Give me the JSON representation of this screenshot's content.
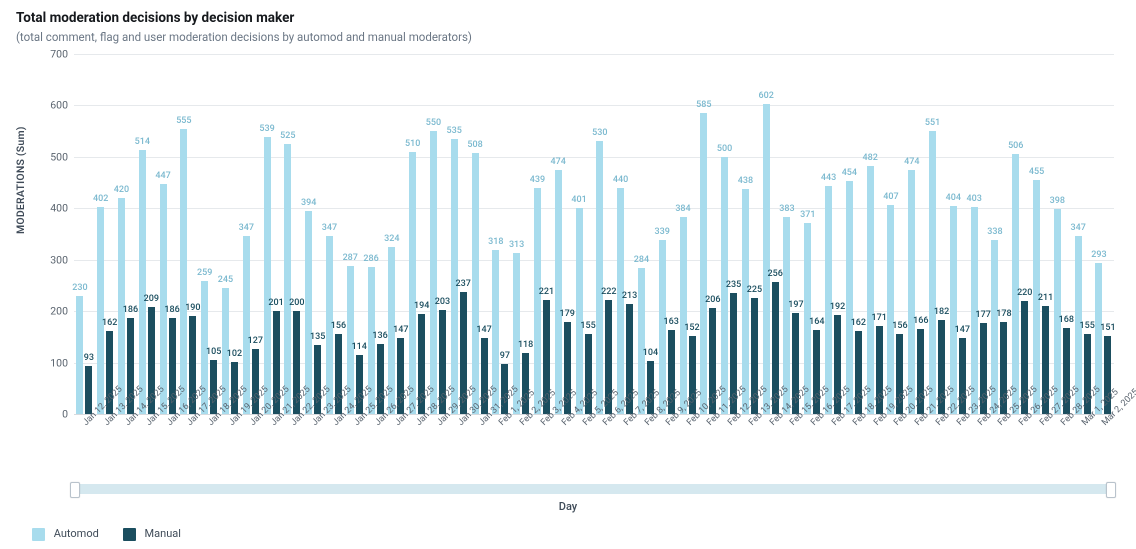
{
  "title": "Total moderation decisions by decision maker",
  "subtitle": "(total comment, flag and user moderation decisions by automod and manual moderators)",
  "legend": {
    "automod": "Automod",
    "manual": "Manual"
  },
  "axis": {
    "y": "MODERATIONS (Sum)",
    "x": "Day"
  },
  "chart_data": {
    "type": "bar",
    "ylim": [
      0,
      700
    ],
    "yticks": [
      0,
      100,
      200,
      300,
      400,
      500,
      600,
      700
    ],
    "categories": [
      "Jan 12, 2025",
      "Jan 13, 2025",
      "Jan 14, 2025",
      "Jan 15, 2025",
      "Jan 16, 2025",
      "Jan 17, 2025",
      "Jan 18, 2025",
      "Jan 19, 2025",
      "Jan 20, 2025",
      "Jan 21, 2025",
      "Jan 22, 2025",
      "Jan 23, 2025",
      "Jan 24, 2025",
      "Jan 25, 2025",
      "Jan 26, 2025",
      "Jan 27, 2025",
      "Jan 28, 2025",
      "Jan 29, 2025",
      "Jan 30, 2025",
      "Jan 31, 2025",
      "Feb 1, 2025",
      "Feb 2, 2025",
      "Feb 3, 2025",
      "Feb 4, 2025",
      "Feb 5, 2025",
      "Feb 6, 2025",
      "Feb 7, 2025",
      "Feb 8, 2025",
      "Feb 9, 2025",
      "Feb 10, 2025",
      "Feb 11, 2025",
      "Feb 12, 2025",
      "Feb 13, 2025",
      "Feb 14, 2025",
      "Feb 15, 2025",
      "Feb 16, 2025",
      "Feb 17, 2025",
      "Feb 18, 2025",
      "Feb 19, 2025",
      "Feb 20, 2025",
      "Feb 21, 2025",
      "Feb 22, 2025",
      "Feb 23, 2025",
      "Feb 24, 2025",
      "Feb 25, 2025",
      "Feb 26, 2025",
      "Feb 27, 2025",
      "Feb 28, 2025",
      "Mar 1, 2025",
      "Mar 2, 2025"
    ],
    "series": [
      {
        "name": "Automod",
        "color": "#a8dced",
        "values": [
          230,
          402,
          420,
          514,
          447,
          555,
          259,
          245,
          347,
          539,
          525,
          394,
          347,
          287,
          286,
          324,
          510,
          550,
          535,
          508,
          318,
          313,
          439,
          474,
          401,
          530,
          440,
          284,
          339,
          384,
          585,
          500,
          438,
          602,
          383,
          371,
          443,
          454,
          482,
          407,
          474,
          551,
          404,
          403,
          338,
          506,
          455,
          398,
          347,
          293
        ]
      },
      {
        "name": "Manual",
        "color": "#1b4e5f",
        "values": [
          93,
          162,
          186,
          209,
          186,
          190,
          105,
          102,
          127,
          201,
          200,
          135,
          156,
          114,
          136,
          147,
          194,
          203,
          237,
          147,
          97,
          118,
          221,
          179,
          155,
          222,
          213,
          104,
          163,
          152,
          206,
          235,
          225,
          256,
          197,
          164,
          192,
          162,
          171,
          156,
          166,
          182,
          147,
          177,
          178,
          220,
          211,
          168,
          155,
          151
        ]
      }
    ],
    "title": "Total moderation decisions by decision maker",
    "xlabel": "Day",
    "ylabel": "MODERATIONS (Sum)"
  }
}
